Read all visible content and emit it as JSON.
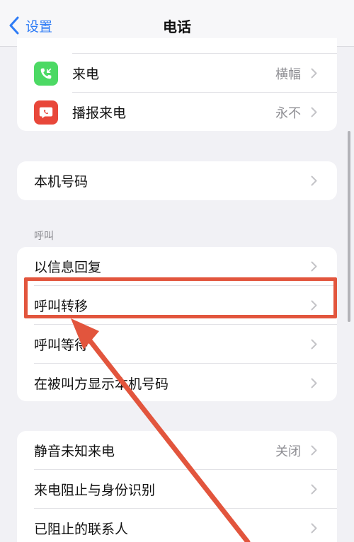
{
  "nav": {
    "back_label": "设置",
    "title": "电话"
  },
  "group1": [
    {
      "label": "来电",
      "value": "横幅",
      "icon": "phone-incoming-icon",
      "color": "#4cd964"
    },
    {
      "label": "播报来电",
      "value": "永不",
      "icon": "speaker-bubble-icon",
      "color": "#e8473a"
    }
  ],
  "group2": [
    {
      "label": "本机号码"
    }
  ],
  "section_calls": {
    "header": "呼叫"
  },
  "group3": [
    {
      "label": "以信息回复"
    },
    {
      "label": "呼叫转移"
    },
    {
      "label": "呼叫等待"
    },
    {
      "label": "在被叫方显示本机号码"
    }
  ],
  "group4": [
    {
      "label": "静音未知来电",
      "value": "关闭"
    },
    {
      "label": "来电阻止与身份识别"
    },
    {
      "label": "已阻止的联系人"
    }
  ],
  "annotation": {
    "color": "#e2553d"
  }
}
